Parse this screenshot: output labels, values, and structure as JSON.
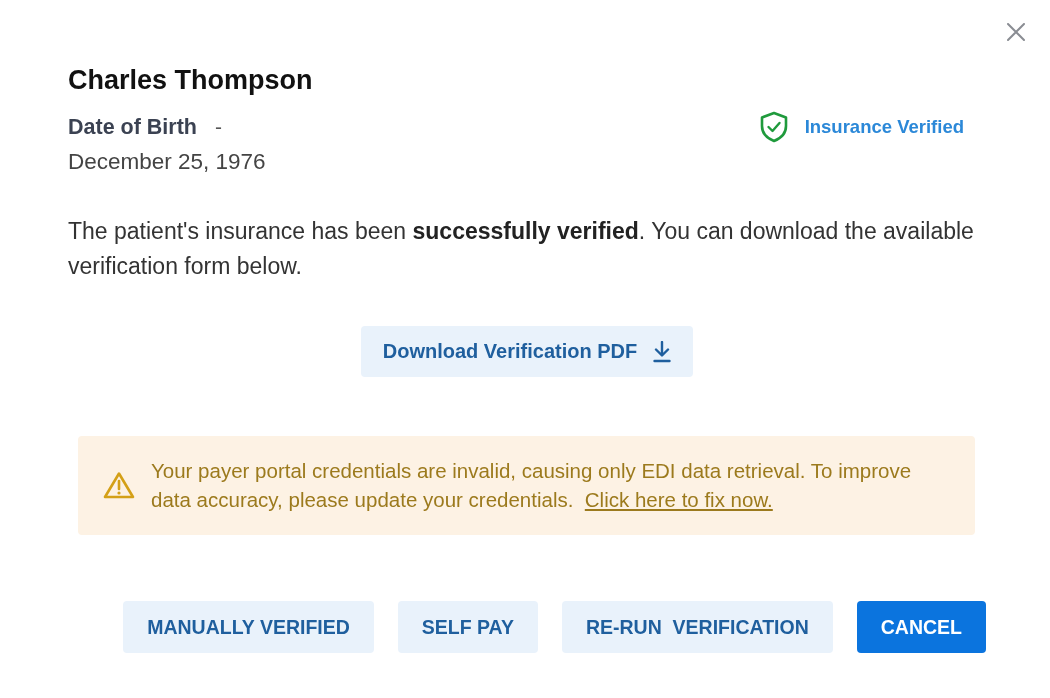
{
  "dialog": {
    "patient": {
      "name": "Charles Thompson",
      "dob_label": "Date of Birth",
      "dob_separator": "-",
      "dob": "December 25, 1976"
    },
    "insurance_status": {
      "kind": "verified",
      "label": "Insurance Verified"
    },
    "message": "The patient's insurance has been **successfully verified**. You can download the available verification form below.",
    "download_button": {
      "label": "Download Verification PDF"
    },
    "alert": {
      "kind": "warning",
      "text": "Your payer portal credentials are invalid, causing only EDI data retrieval. To improve data accuracy, please update your credentials.",
      "link": "Click here to fix now."
    },
    "buttons": [
      {
        "label": "MANUALLY VERIFIED",
        "kind": "secondary"
      },
      {
        "label": "SELF PAY",
        "kind": "secondary"
      },
      {
        "label": "RE-RUN  VERIFICATION",
        "kind": "secondary"
      },
      {
        "label": "CANCEL",
        "kind": "primary"
      }
    ]
  }
}
